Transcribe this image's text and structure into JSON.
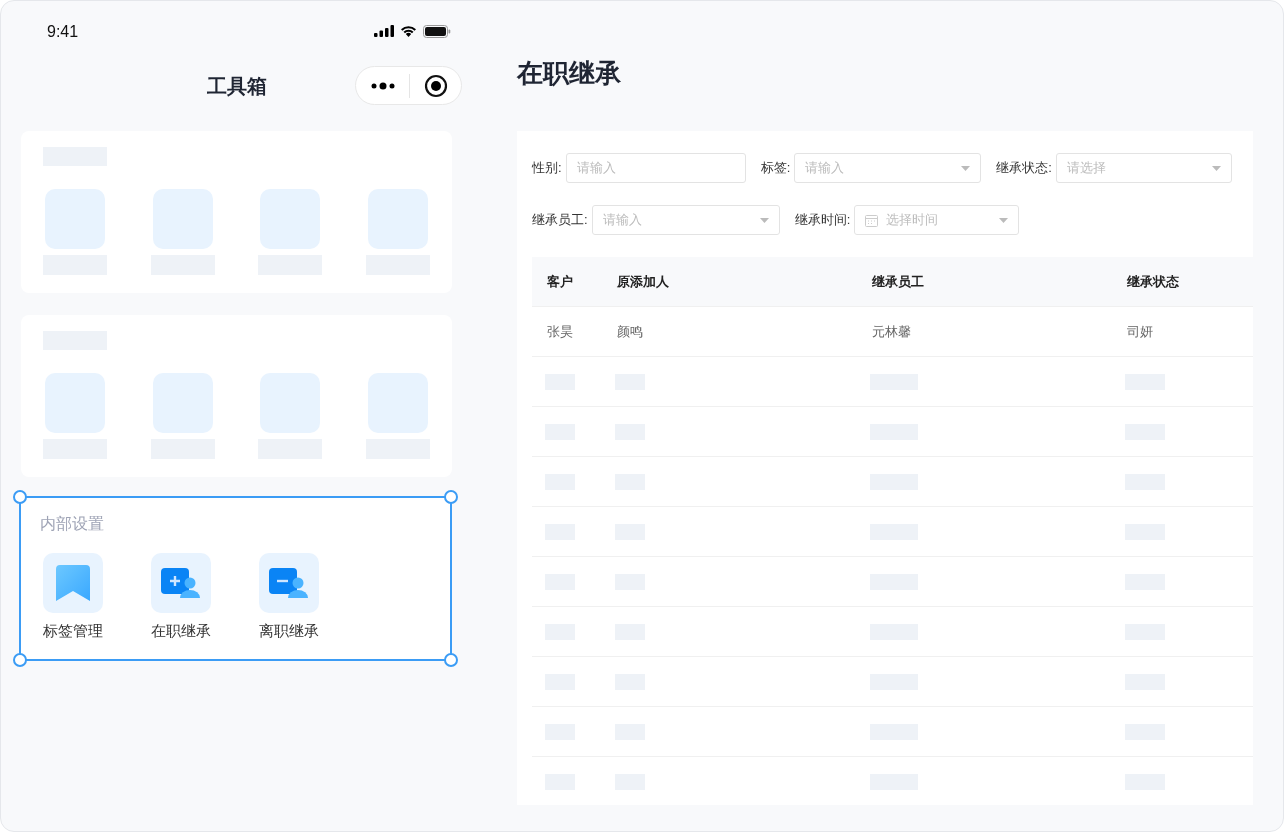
{
  "status_bar": {
    "time": "9:41"
  },
  "nav": {
    "title": "工具箱"
  },
  "section": {
    "title": "内部设置",
    "selected": true,
    "items": [
      {
        "kind": "bookmark",
        "label": "标签管理"
      },
      {
        "kind": "add-user",
        "label": "在职继承"
      },
      {
        "kind": "remove-user",
        "label": "离职继承"
      }
    ]
  },
  "page": {
    "title": "在职继承"
  },
  "filter_rows": [
    [
      {
        "label": "性别:",
        "kind": "text",
        "placeholder": "请输入"
      },
      {
        "label": "标签:",
        "kind": "select",
        "placeholder": "请输入"
      },
      {
        "label": "继承状态:",
        "kind": "select",
        "placeholder": "请选择"
      }
    ],
    [
      {
        "label": "继承员工:",
        "kind": "select",
        "placeholder": "请输入"
      },
      {
        "label": "继承时间:",
        "kind": "date",
        "placeholder": "选择时间"
      }
    ]
  ],
  "table": {
    "columns": [
      "客户",
      "原添加人",
      "继承员工",
      "继承状态"
    ],
    "rows": [
      [
        "张昊",
        "颜鸣",
        "元林馨",
        "司妍"
      ]
    ]
  }
}
